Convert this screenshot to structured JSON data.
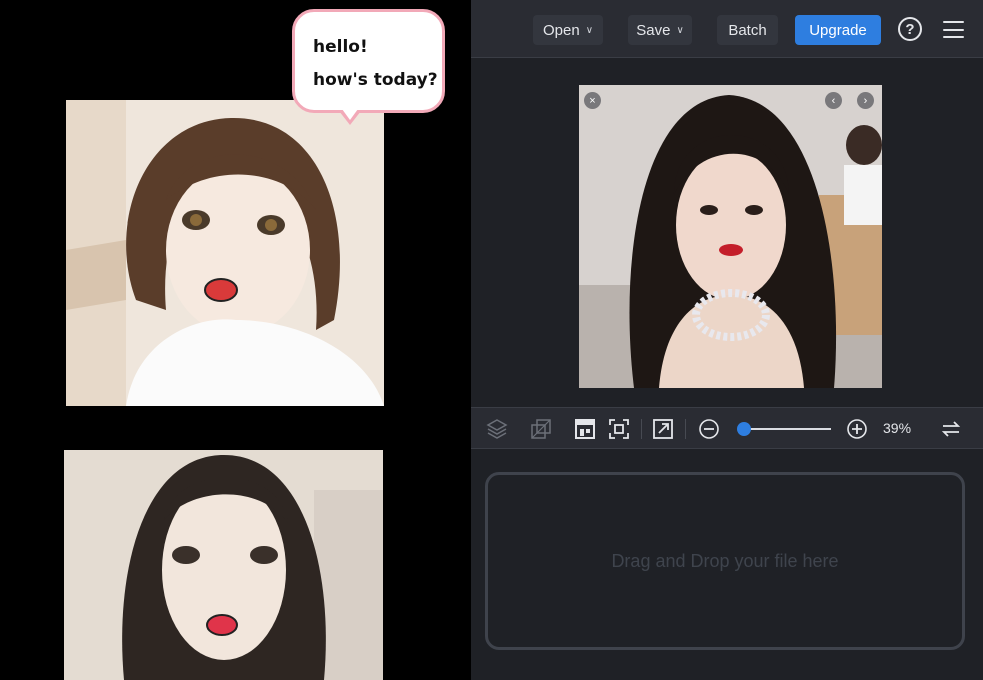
{
  "canvas": {
    "bubble_lines": [
      "hello!",
      "how's today?"
    ]
  },
  "toolbar_top": {
    "open_label": "Open",
    "save_label": "Save",
    "batch_label": "Batch",
    "upgrade_label": "Upgrade",
    "help_label": "?",
    "accent_color": "#2e7ee0"
  },
  "preview": {
    "close_label": "×",
    "prev_label": "‹",
    "next_label": "›"
  },
  "tools": {
    "zoom_level": "39%",
    "zoom_fraction": 0.05
  },
  "dropzone": {
    "text": "Drag and Drop your file here"
  }
}
